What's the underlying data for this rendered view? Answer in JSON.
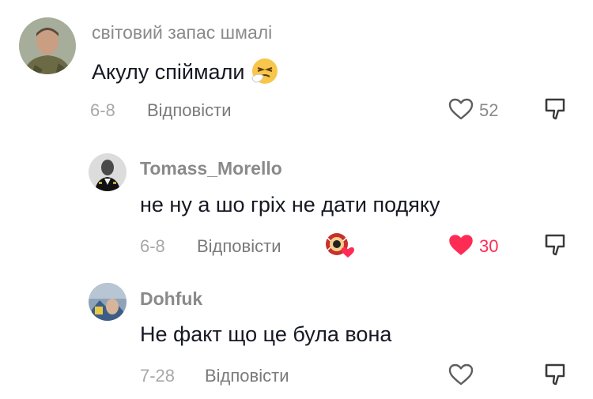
{
  "comments": [
    {
      "username": "світовий запас шмалі",
      "text": "Акулу спіймали",
      "date": "6-8",
      "reply_label": "Відповісти",
      "likes": "52",
      "liked": false
    },
    {
      "username": "Tomass_Morello",
      "text": "не ну а шо гріх не дати подяку",
      "date": "6-8",
      "reply_label": "Відповісти",
      "likes": "30",
      "liked": true
    },
    {
      "username": "Dohfuk",
      "text": "Не факт що це була вона",
      "date": "7-28",
      "reply_label": "Відповісти",
      "likes": "",
      "liked": false
    }
  ],
  "colors": {
    "like_active": "#fe2c55",
    "text_primary": "#161823",
    "text_secondary": "#8a8a8a"
  },
  "icons": [
    "sneezing-face-emoji",
    "heart-outline-icon",
    "heart-filled-icon",
    "dislike-icon",
    "creator-liked-avatar"
  ]
}
